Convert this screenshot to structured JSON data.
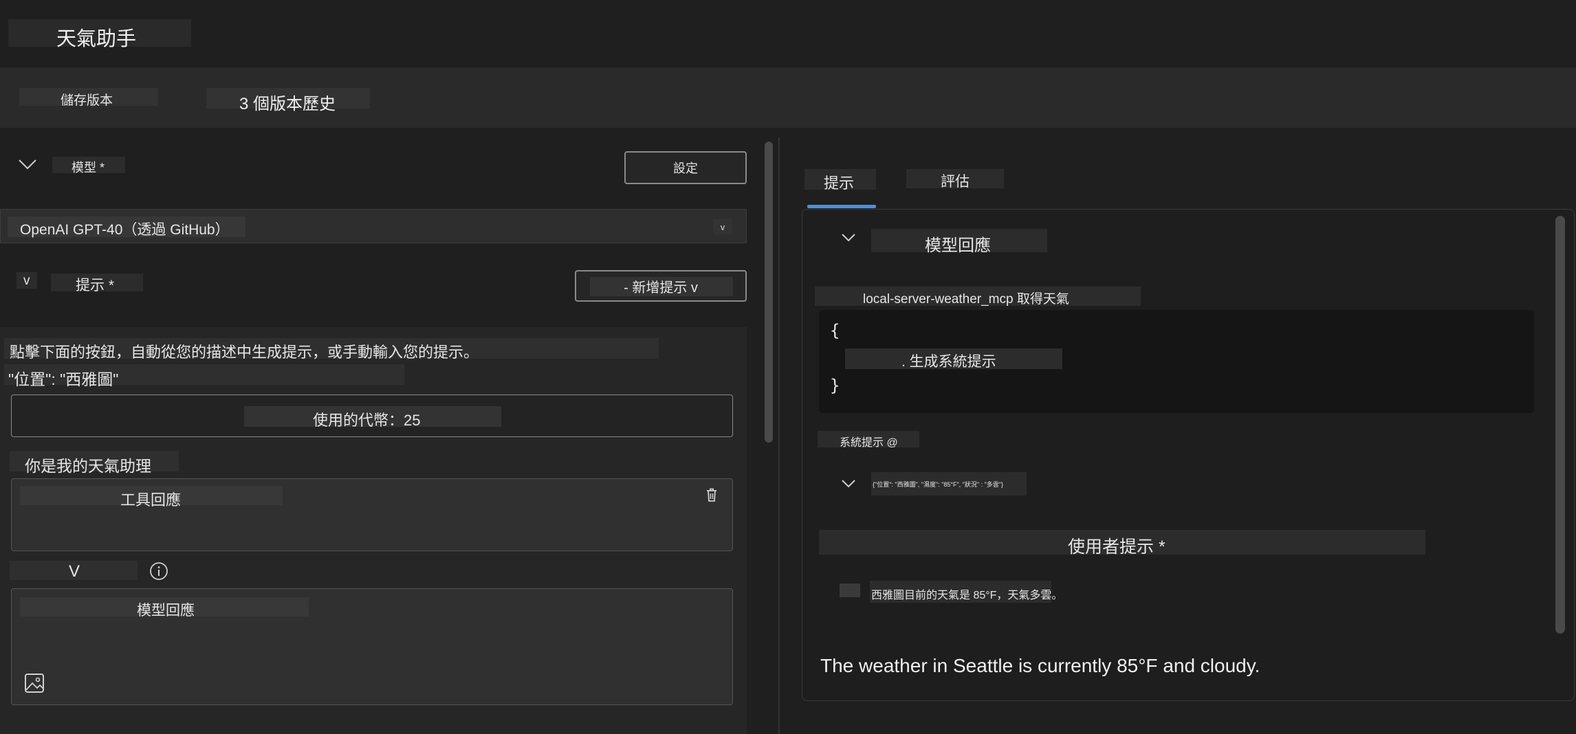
{
  "app": {
    "title": "天氣助手"
  },
  "toolbar": {
    "save_label": "儲存版本",
    "history_label": "3 個版本歷史"
  },
  "left": {
    "model_section": {
      "label": "模型 *",
      "settings_label": "設定",
      "selected_model": "OpenAI GPT-40（透過 GitHub）"
    },
    "prompt_section": {
      "label": "提示 *",
      "add_prompt_label": "- 新增提示 v",
      "chevron_text": "v",
      "description": "點擊下面的按鈕，自動從您的描述中生成提示，或手動輸入您的提示。",
      "location_line": "\"位置\": \"西雅圖\"",
      "tokens_label": "使用的代幣：25",
      "assistant_text": "你是我的天氣助理",
      "tool_response_label": "工具回應",
      "collapse_text": "V",
      "model_response_label": "模型回應"
    }
  },
  "right": {
    "tabs": [
      {
        "label": "提示",
        "active": true
      },
      {
        "label": "評估",
        "active": false
      }
    ],
    "model_response_title": "模型回應",
    "tool_call_label": "local-server-weather_mcp 取得天氣",
    "code_block": {
      "open_brace": "{",
      "line": ". 生成系統提示",
      "close_brace": "}"
    },
    "system_prompt_label": "系統提示 @",
    "json_snippet": "{\"位置\": \"西雅圖\", \"濕度\": \"85°F\", \"狀況\" : \"多雲\"}",
    "user_prompt_title": "使用者提示 *",
    "user_prompt_text": "西雅圖目前的天氣是 85°F，天氣多雲。",
    "final_response": "The weather in Seattle is currently 85°F and cloudy."
  },
  "colors": {
    "background": "#1f1f1f",
    "panel": "#252526",
    "accent": "#4a90e2",
    "code_bg": "#151515"
  }
}
